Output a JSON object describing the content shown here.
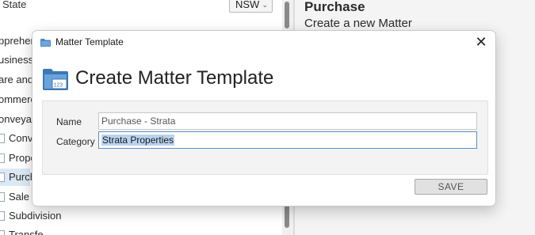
{
  "background": {
    "state_label": "State",
    "state_value": "NSW",
    "tree_items": [
      "pprehen",
      "usiness",
      "are and",
      "ommerc",
      "onveyan",
      "Conve",
      "Propo",
      "Purch",
      "Sale",
      "Subdivision",
      "Transfe"
    ],
    "right_panel": {
      "title": "Purchase",
      "subtitle": "Create a new Matter"
    }
  },
  "dialog": {
    "window_title": "Matter Template",
    "heading": "Create Matter Template",
    "fields": {
      "name_label": "Name",
      "name_value": "Purchase - Strata",
      "category_label": "Category",
      "category_value": "Strata Properties"
    },
    "save_label": "SAVE",
    "close_glyph": "✕"
  },
  "colors": {
    "accent": "#5b8fc7",
    "selection": "#b9d3ef",
    "icon_blue": "#4a86c5"
  },
  "icons": [
    "folder-icon",
    "calendar-folder-icon",
    "close-icon",
    "chevron-down-icon"
  ]
}
